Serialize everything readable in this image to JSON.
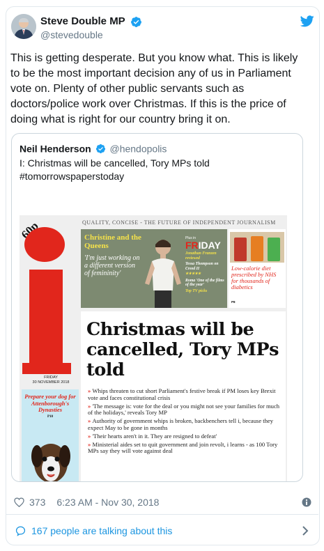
{
  "author": {
    "name": "Steve Double MP",
    "handle": "@stevedouble",
    "verified": true
  },
  "tweet": {
    "text": "This is getting desperate. But you know what. This is likely to be the most important decision any of us in Parliament vote on. Plenty of other public servants such as doctors/police work over Christmas. If this is the price of doing what is right for our country bring it on."
  },
  "quoted_tweet": {
    "name": "Neil Henderson",
    "handle": "@hendopolis",
    "verified": true,
    "text": "I: Christmas will be cancelled, Tory MPs told #tomorrowspaperstoday",
    "image": {
      "price": "60p",
      "masthead_line": "QUALITY, CONCISE - THE FUTURE OF INDEPENDENT JOURNALISM",
      "dateline": [
        "FRIDAY",
        "30 NOVEMBER 2018"
      ],
      "dog_promo": "Prepare your dog for Attenborough's Dynasties",
      "dog_page": "P10",
      "feature_title": "Christine and the Queens",
      "feature_quote": "'I'm just working on a different version of femininity'",
      "friday_plus": "Plus in",
      "friday_title_red": "FR",
      "friday_title_rest": "IDAY",
      "friday_items": [
        "Jonathan Franzen reviewed",
        "Tessa Thompson on Creed II",
        "★★★★★",
        "Roma 'One of the films of the year'",
        "Top TV picks"
      ],
      "diet_text": "Low-calorie diet prescribed by NHS for thousands of diabetics",
      "diet_page": "P8",
      "headline": "Christmas will be cancelled, Tory MPs told",
      "bullets": [
        "Whips threaten to cut short Parliament's festive break if PM loses key Brexit vote and faces constitutional crisis",
        "'The message is: vote for the deal or you might not see your families for much of the holidays,' reveals Tory MP",
        "Authority of government whips is broken, backbenchers tell i, because they expect May to be gone in months",
        "'Their hearts aren't in it. They are resigned to defeat'",
        "Ministerial aides set to quit government and join revolt, i learns - as 100 Tory MPs say they will vote against deal"
      ]
    }
  },
  "meta": {
    "likes": "373",
    "timestamp": "6:23 AM - Nov 30, 2018"
  },
  "footer": {
    "talking": "167 people are talking about this"
  },
  "colors": {
    "twitter_blue": "#1da1f2",
    "link_blue": "#1b95e0",
    "muted": "#657786",
    "border": "#e1e8ed",
    "i_red": "#e1261c"
  }
}
